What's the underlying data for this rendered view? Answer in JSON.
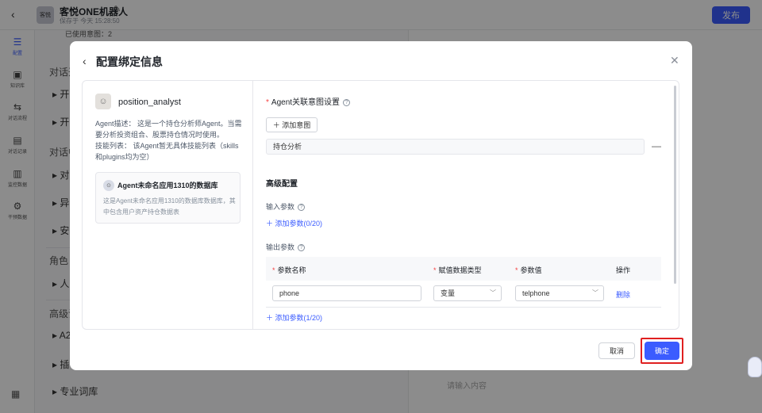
{
  "app": {
    "avatar_text": "客悦",
    "name": "客悦ONE机器人",
    "save_status": "保存于 今天 15:28:50",
    "publish": "发布"
  },
  "nav": [
    {
      "label": "配置",
      "icon": "☰"
    },
    {
      "label": "知识库",
      "icon": "▣"
    },
    {
      "label": "对话流程",
      "icon": "⇆"
    },
    {
      "label": "对话记录",
      "icon": "▤"
    },
    {
      "label": "监控数据",
      "icon": "▥"
    },
    {
      "label": "干预数据",
      "icon": "⚙"
    }
  ],
  "background": {
    "used_intents": "已使用意图：2",
    "section_dialogue_1": "对话开",
    "section_dialogue_2": "对话中",
    "section_role": "角色",
    "section_advanced": "高级设",
    "rows": [
      "开",
      "开",
      "对",
      "异",
      "安",
      "人",
      "A2",
      "插",
      "专业词库"
    ],
    "chat_placeholder": "请输入内容"
  },
  "modal": {
    "title": "配置绑定信息",
    "agent": {
      "name": "position_analyst",
      "desc": "Agent描述： 这是一个持仓分析师Agent。当需要分析投资组合、股票持仓情况时使用。",
      "skills": "技能列表： 该Agent暂无具体技能列表（skills和plugins均为空）",
      "db_title": "Agent未命名应用1310的数据库",
      "db_desc": "这是Agent未命名应用1310的数据库数据库，其中包含用户资产持仓数据表"
    },
    "intent_section_title": "Agent关联意图设置",
    "add_intent": "添加意图",
    "intent_value": "持仓分析",
    "advanced_title": "高级配置",
    "input_params_label": "输入参数",
    "add_input_param": "添加参数(0/20)",
    "output_params_label": "输出参数",
    "table": {
      "headers": {
        "name": "参数名称",
        "type": "赋值数据类型",
        "value": "参数值",
        "action": "操作"
      },
      "rows": [
        {
          "name": "phone",
          "type": "变量",
          "value": "telphone",
          "action": "删除"
        }
      ]
    },
    "add_output_param": "添加参数(1/20)",
    "cancel": "取消",
    "confirm": "确定"
  }
}
